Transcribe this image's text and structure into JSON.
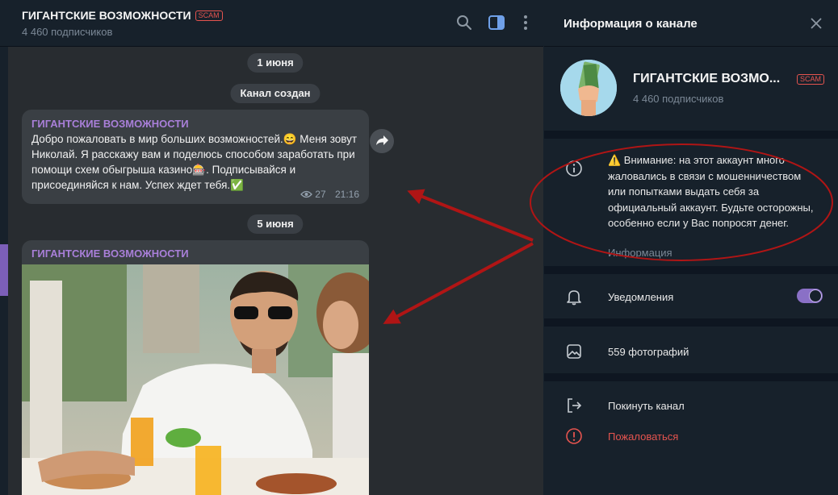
{
  "chat": {
    "title": "ГИГАНТСКИЕ ВОЗМОЖНОСТИ",
    "scam_badge": "SCAM",
    "subscribers": "4 460 подписчиков",
    "dates": [
      "1 июня",
      "Канал создан",
      "5 июня"
    ],
    "messages": [
      {
        "author": "ГИГАНТСКИЕ ВОЗМОЖНОСТИ",
        "text": "Добро пожаловать в мир больших возможностей.😄 Меня зовут Николай. Я расскажу вам и поделюсь способом заработать при помощи схем обыгрыша казино🎰. Подписывайся и присоединяйся к нам. Успех ждет тебя.✅",
        "views": "27",
        "time": "21:16"
      },
      {
        "author": "ГИГАНТСКИЕ ВОЗМОЖНОСТИ"
      }
    ]
  },
  "panel": {
    "title": "Информация о канале",
    "channel_name": "ГИГАНТСКИЕ ВОЗМО...",
    "scam_badge": "SCAM",
    "subscribers": "4 460 подписчиков",
    "warning": "⚠️ Внимание: на этот аккаунт много жаловались в связи с мошенничеством или попытками выдать себя за официальный аккаунт. Будьте осторожны, особенно если у Вас попросят денег.",
    "info_caption": "Информация",
    "notifications_label": "Уведомления",
    "notifications_on": true,
    "photos_label": "559 фотографий",
    "leave_label": "Покинуть канал",
    "report_label": "Пожаловаться"
  },
  "icons": [
    "search-icon",
    "sidebar-toggle-icon",
    "more-icon",
    "close-icon",
    "forward-icon",
    "eye-icon",
    "info-icon",
    "bell-icon",
    "photos-icon",
    "leave-icon",
    "report-icon"
  ],
  "colors": {
    "accent": "#8a70c6",
    "scam": "#e5544f",
    "author": "#a97fd9",
    "annotation": "#b01515"
  }
}
